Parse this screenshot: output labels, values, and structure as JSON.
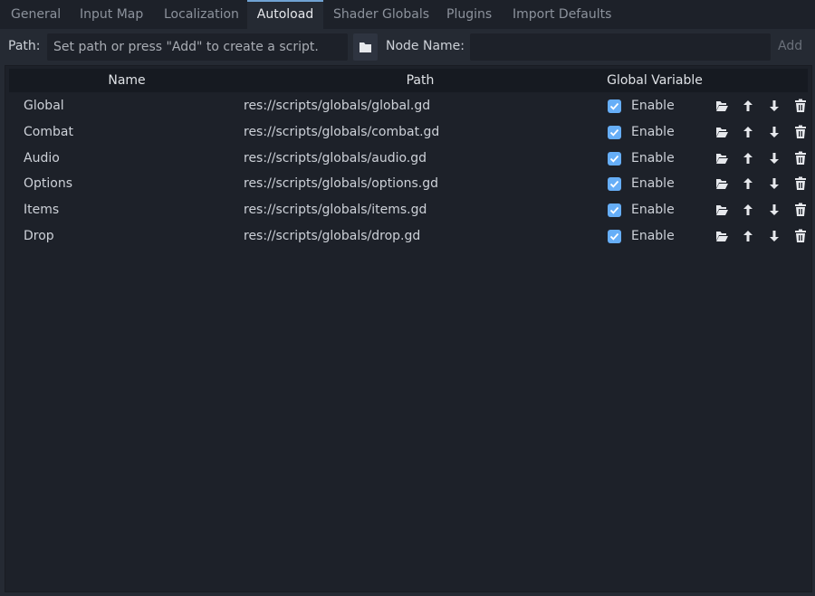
{
  "tabs": [
    "General",
    "Input Map",
    "Localization",
    "Autoload",
    "Shader Globals",
    "Plugins",
    "Import Defaults"
  ],
  "active_tab": "Autoload",
  "toolbar": {
    "path_label": "Path:",
    "path_placeholder": "Set path or press \"Add\" to create a script.",
    "node_name_label": "Node Name:",
    "node_name_value": "",
    "add_label": "Add"
  },
  "table": {
    "headers": {
      "name": "Name",
      "path": "Path",
      "global": "Global Variable"
    },
    "rows": [
      {
        "name": "Global",
        "path": "res://scripts/globals/global.gd",
        "enabled": true,
        "enable_label": "Enable"
      },
      {
        "name": "Combat",
        "path": "res://scripts/globals/combat.gd",
        "enabled": true,
        "enable_label": "Enable"
      },
      {
        "name": "Audio",
        "path": "res://scripts/globals/audio.gd",
        "enabled": true,
        "enable_label": "Enable"
      },
      {
        "name": "Options",
        "path": "res://scripts/globals/options.gd",
        "enabled": true,
        "enable_label": "Enable"
      },
      {
        "name": "Items",
        "path": "res://scripts/globals/items.gd",
        "enabled": true,
        "enable_label": "Enable"
      },
      {
        "name": "Drop",
        "path": "res://scripts/globals/drop.gd",
        "enabled": true,
        "enable_label": "Enable"
      }
    ],
    "row_actions": [
      "folder-open-icon",
      "move-up-icon",
      "move-down-icon",
      "remove-icon"
    ]
  },
  "colors": {
    "accent": "#70a3d4",
    "checkbox": "#66aef7",
    "background": "#1d2129",
    "panel": "#252a33",
    "header": "#161a21"
  }
}
